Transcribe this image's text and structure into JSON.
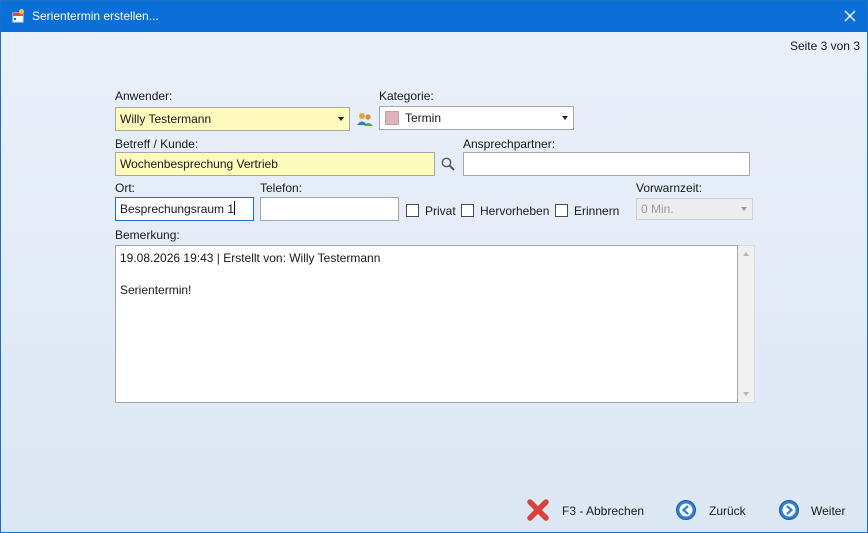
{
  "window": {
    "title": "Serientermin erstellen...",
    "page_indicator": "Seite 3 von 3"
  },
  "form": {
    "anwender": {
      "label": "Anwender:",
      "value": "Willy Testermann"
    },
    "kategorie": {
      "label": "Kategorie:",
      "value": "Termin",
      "swatch_color": "#dcb3b8"
    },
    "betreff": {
      "label": "Betreff / Kunde:",
      "value": "Wochenbesprechung Vertrieb"
    },
    "ansprechpartner": {
      "label": "Ansprechpartner:",
      "value": ""
    },
    "ort": {
      "label": "Ort:",
      "value": "Besprechungsraum 1"
    },
    "telefon": {
      "label": "Telefon:",
      "value": ""
    },
    "checkboxes": {
      "privat": {
        "label": "Privat",
        "checked": false
      },
      "hervorheben": {
        "label": "Hervorheben",
        "checked": false
      },
      "erinnern": {
        "label": "Erinnern",
        "checked": false
      }
    },
    "vorwarnzeit": {
      "label": "Vorwarnzeit:",
      "value": "0 Min."
    },
    "bemerkung": {
      "label": "Bemerkung:",
      "line1": "19.08.2026 19:43 | Erstellt von: Willy Testermann",
      "line2": "Serientermin!"
    }
  },
  "footer": {
    "cancel_label": "F3 - Abbrechen",
    "back_label": "Zurück",
    "next_label": "Weiter"
  },
  "colors": {
    "titlebar": "#0a6fd6",
    "required_field": "#fffbbd",
    "focus_border": "#1e6fc8"
  }
}
